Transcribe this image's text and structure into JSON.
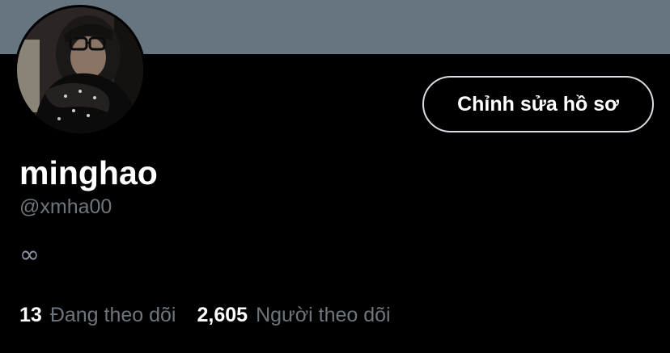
{
  "profile": {
    "display_name": "minghao",
    "handle": "@xmha00",
    "bio": "∞",
    "edit_button_label": "Chỉnh sửa hồ sơ",
    "banner_color": "#66757f"
  },
  "stats": {
    "following_count": "13",
    "following_label": "Đang theo dõi",
    "followers_count": "2,605",
    "followers_label": "Người theo dõi"
  }
}
